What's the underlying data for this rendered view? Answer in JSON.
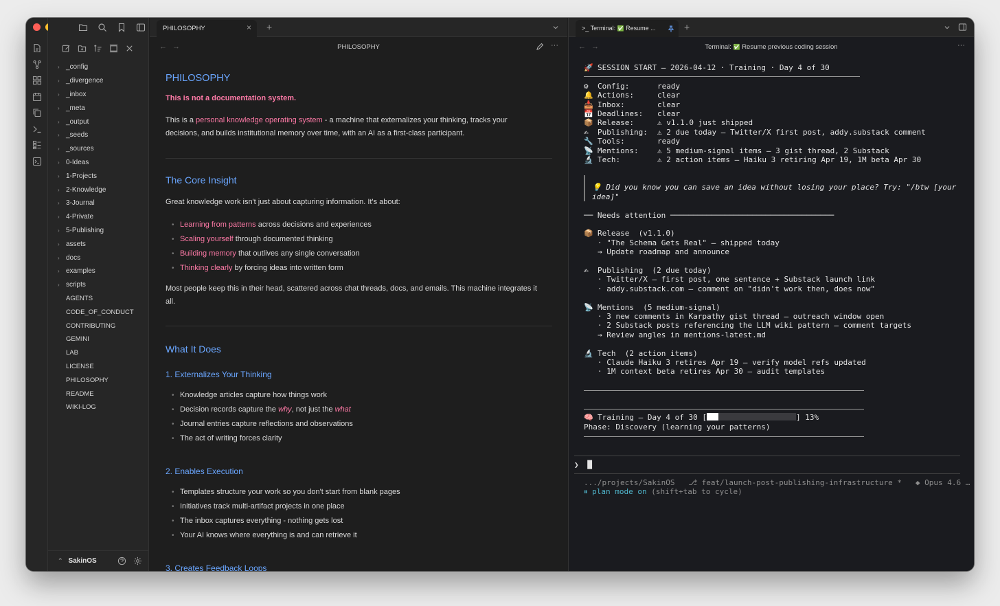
{
  "colors": {
    "accent": "#6aa6ff",
    "highlight": "#ff7aa7",
    "traffic_red": "#ff5f57",
    "traffic_yellow": "#febc2e",
    "traffic_green": "#28c840",
    "terminal_bg": "#1a1b1f",
    "progress_fill": "#ffffff"
  },
  "sidebar": {
    "items": [
      {
        "label": "_config",
        "type": "folder"
      },
      {
        "label": "_divergence",
        "type": "folder"
      },
      {
        "label": "_inbox",
        "type": "folder"
      },
      {
        "label": "_meta",
        "type": "folder"
      },
      {
        "label": "_output",
        "type": "folder"
      },
      {
        "label": "_seeds",
        "type": "folder"
      },
      {
        "label": "_sources",
        "type": "folder"
      },
      {
        "label": "0-Ideas",
        "type": "folder"
      },
      {
        "label": "1-Projects",
        "type": "folder"
      },
      {
        "label": "2-Knowledge",
        "type": "folder"
      },
      {
        "label": "3-Journal",
        "type": "folder"
      },
      {
        "label": "4-Private",
        "type": "folder"
      },
      {
        "label": "5-Publishing",
        "type": "folder"
      },
      {
        "label": "assets",
        "type": "folder"
      },
      {
        "label": "docs",
        "type": "folder"
      },
      {
        "label": "examples",
        "type": "folder"
      },
      {
        "label": "scripts",
        "type": "folder"
      },
      {
        "label": "AGENTS",
        "type": "file"
      },
      {
        "label": "CODE_OF_CONDUCT",
        "type": "file"
      },
      {
        "label": "CONTRIBUTING",
        "type": "file"
      },
      {
        "label": "GEMINI",
        "type": "file"
      },
      {
        "label": "LAB",
        "type": "file"
      },
      {
        "label": "LICENSE",
        "type": "file"
      },
      {
        "label": "PHILOSOPHY",
        "type": "file"
      },
      {
        "label": "README",
        "type": "file"
      },
      {
        "label": "WIKI-LOG",
        "type": "file"
      }
    ],
    "vault_name": "SakinOS"
  },
  "note_tab": {
    "label": "PHILOSOPHY",
    "close": "×",
    "new": "+"
  },
  "note_header": {
    "title": "PHILOSOPHY"
  },
  "note": {
    "h1": "PHILOSOPHY",
    "tagline": "This is not a documentation system.",
    "intro_pre": "This is a ",
    "intro_hl": "personal knowledge operating system",
    "intro_line1_post": " - a machine that externalizes your thinking, tracks your",
    "intro_line2": "decisions, and builds institutional memory over time, with an AI as a first-class participant.",
    "core_heading": "The Core Insight",
    "core_para": "Great knowledge work isn't just about capturing information. It's about:",
    "core_bullets": [
      {
        "hl": "Learning from patterns",
        "rest": " across decisions and experiences"
      },
      {
        "hl": "Scaling yourself",
        "rest": " through documented thinking"
      },
      {
        "hl": "Building memory",
        "rest": " that outlives any single conversation"
      },
      {
        "hl": "Thinking clearly",
        "rest": " by forcing ideas into written form"
      }
    ],
    "core_outro_line1": "Most people keep this in their head, scattered across chat threads, docs, and emails. This machine integrates it",
    "core_outro_line2": "all.",
    "what_heading": "What It Does",
    "sub1": "1. Externalizes Your Thinking",
    "sub1_b1": "Knowledge articles capture how things work",
    "sub1_b2_pre": "Decision records capture the ",
    "sub1_b2_why": "why",
    "sub1_b2_mid": ", not just the ",
    "sub1_b2_what": "what",
    "sub1_b3": "Journal entries capture reflections and observations",
    "sub1_b4": "The act of writing forces clarity",
    "sub2": "2. Enables Execution",
    "sub2_bullets": [
      "Templates structure your work so you don't start from blank pages",
      "Initiatives track multi-artifact projects in one place",
      "The inbox captures everything - nothing gets lost",
      "Your AI knows where everything is and can retrieve it"
    ],
    "sub3": "3. Creates Feedback Loops"
  },
  "terminal_tab": {
    "prefix": ">_",
    "label": "Terminal:",
    "status_icon": "✅",
    "short_title": "Resume ...",
    "new": "+"
  },
  "terminal_header": {
    "label": "Terminal:",
    "title": "Resume previous coding session"
  },
  "terminal": {
    "session_line": "SESSION START — 2026-04-12 · Training · Day 4 of 30",
    "status_rows": [
      {
        "icon": "⚙",
        "key": "Config:",
        "value": "ready"
      },
      {
        "icon": "🔔",
        "key": "Actions:",
        "value": "clear"
      },
      {
        "icon": "📥",
        "key": "Inbox:",
        "value": "clear"
      },
      {
        "icon": "📅",
        "key": "Deadlines:",
        "value": "clear"
      },
      {
        "icon": "📦",
        "key": "Release:",
        "value": "⚠ v1.1.0 just shipped"
      },
      {
        "icon": "✍",
        "key": "Publishing:",
        "value": "⚠ 2 due today — Twitter/X first post, addy.substack comment"
      },
      {
        "icon": "🔧",
        "key": "Tools:",
        "value": "ready"
      },
      {
        "icon": "📡",
        "key": "Mentions:",
        "value": "⚠ 5 medium-signal items — 3 gist thread, 2 Substack"
      },
      {
        "icon": "🔬",
        "key": "Tech:",
        "value": "⚠ 2 action items — Haiku 3 retiring Apr 19, 1M beta Apr 30"
      }
    ],
    "tip_line1": "💡 Did you know you can save an idea without losing your place? Try: \"/btw [your",
    "tip_line2": "idea]\"",
    "needs_attention": "Needs attention",
    "sections": [
      {
        "icon": "📦",
        "title": "Release  (v1.1.0)",
        "lines": [
          "· \"The Schema Gets Real\" — shipped today",
          "→ Update roadmap and announce"
        ]
      },
      {
        "icon": "✍",
        "title": "Publishing  (2 due today)",
        "lines": [
          "· Twitter/X — first post, one sentence + Substack launch link",
          "· addy.substack.com — comment on \"didn't work then, does now\""
        ]
      },
      {
        "icon": "📡",
        "title": "Mentions  (5 medium-signal)",
        "lines": [
          "· 3 new comments in Karpathy gist thread — outreach window open",
          "· 2 Substack posts referencing the LLM wiki pattern — comment targets",
          "→ Review angles in mentions-latest.md"
        ]
      },
      {
        "icon": "🔬",
        "title": "Tech  (2 action items)",
        "lines": [
          "· Claude Haiku 3 retires Apr 19 — verify model refs updated",
          "· 1M context beta retires Apr 30 — audit templates"
        ]
      }
    ],
    "training_icon": "🧠",
    "training_label": "Training — Day 4 of 30 [",
    "training_end": "] 13%",
    "training_progress": 0.13,
    "phase_line": "Phase: Discovery (learning your patterns)",
    "prompt": "❯",
    "cursor": "█",
    "status_path": ".../projects/SakinOS",
    "status_branch": "⎇ feat/launch-post-publishing-infrastructure *",
    "status_model": "◆ Opus 4.6 …",
    "mode_icon": "⏸",
    "mode_text": "plan mode on",
    "mode_hint": "(shift+tab to cycle)"
  }
}
